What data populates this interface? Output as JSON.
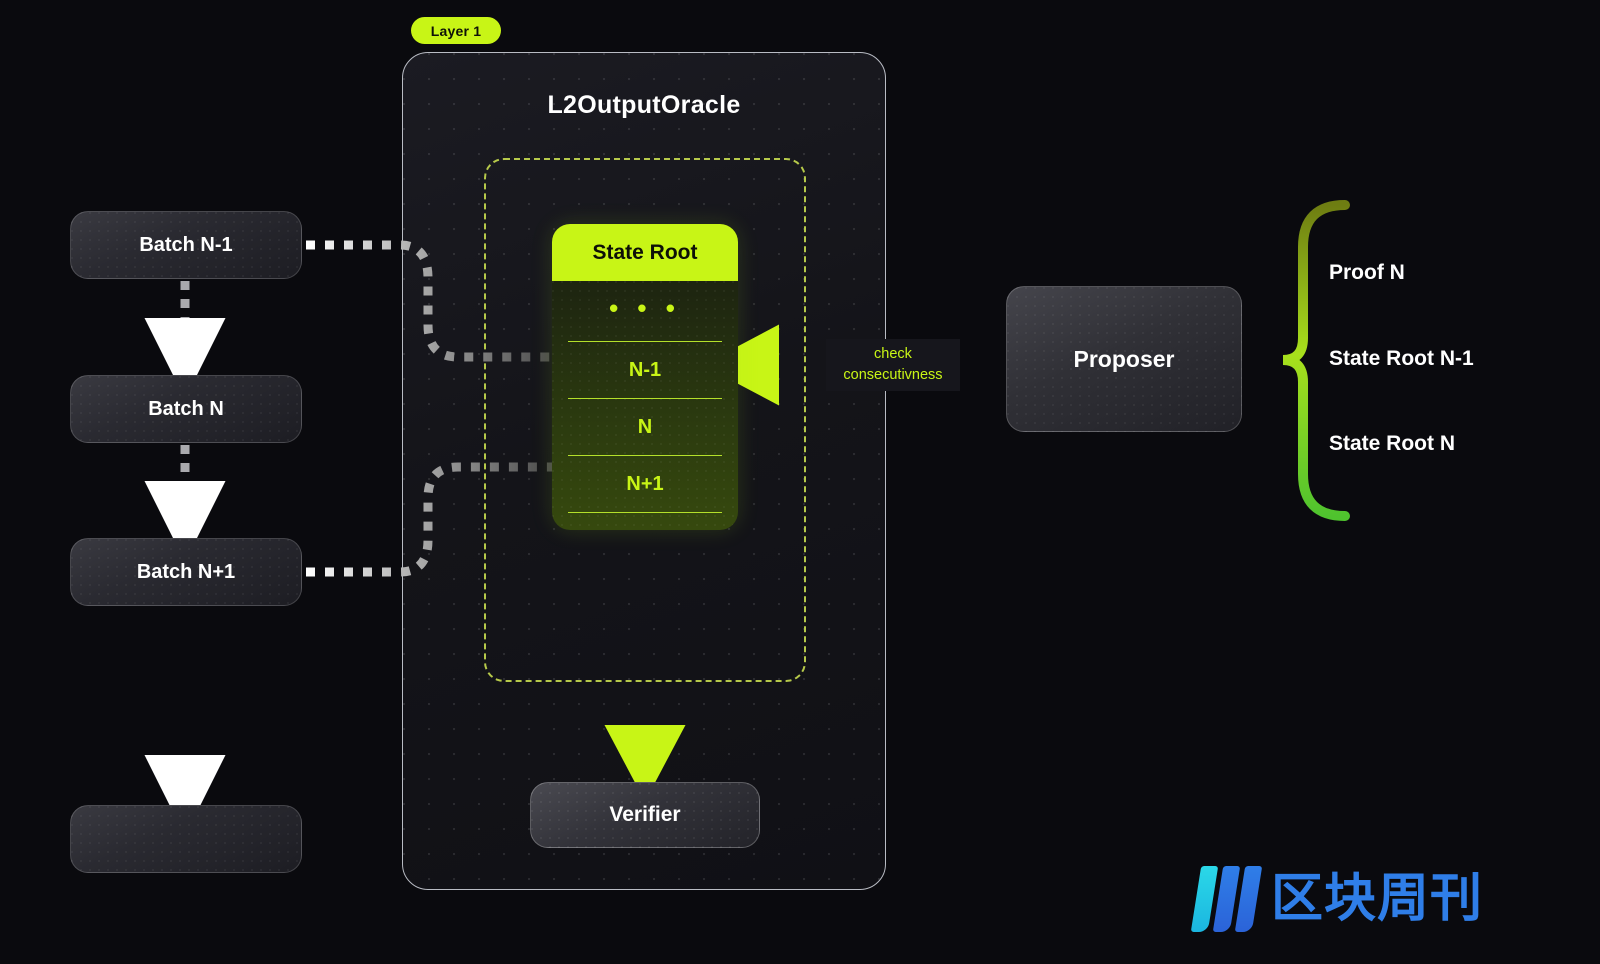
{
  "background_color": "#0a0a0e",
  "accent_green": "#c8f516",
  "badge": {
    "label": "Layer 1"
  },
  "l1_container": {
    "title": "L2OutputOracle"
  },
  "state_root": {
    "header": "State Root",
    "rows": [
      {
        "label": "• • •",
        "is_ellipsis": true
      },
      {
        "label": "N-1",
        "is_ellipsis": false
      },
      {
        "label": "N",
        "is_ellipsis": false
      },
      {
        "label": "N+1",
        "is_ellipsis": false
      }
    ]
  },
  "batches": [
    {
      "label": "Batch N-1"
    },
    {
      "label": "Batch N"
    },
    {
      "label": "Batch N+1"
    },
    {
      "label": ""
    }
  ],
  "verifier": {
    "label": "Verifier"
  },
  "proposer": {
    "label": "Proposer"
  },
  "check_label": {
    "line1": "check",
    "line2": "consecutivness"
  },
  "right_outputs": [
    {
      "label": "Proof N"
    },
    {
      "label": "State Root N-1"
    },
    {
      "label": "State Root N"
    }
  ],
  "watermark": {
    "text": "区块周刊",
    "bar_colors": [
      "#2bd8e8",
      "#2f7ee8",
      "#2f7ee8"
    ]
  }
}
